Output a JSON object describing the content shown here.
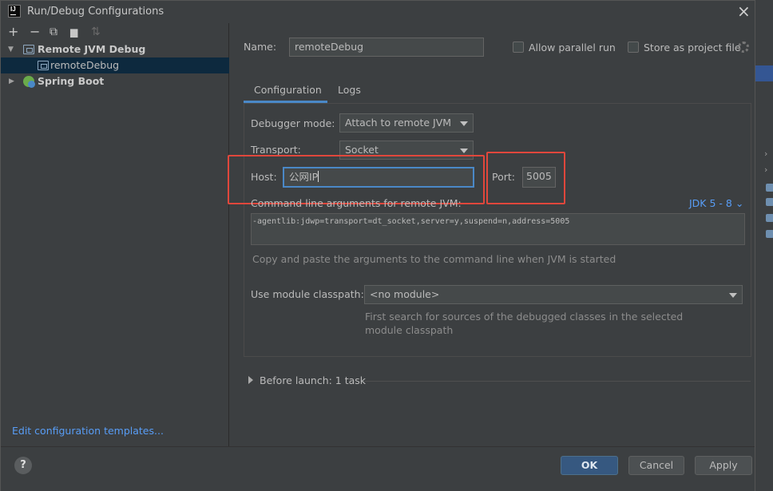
{
  "window": {
    "title": "Run/Debug Configurations",
    "app_icon": "IJ"
  },
  "toolbar": {
    "add": "+",
    "remove": "−",
    "copy": "⧉",
    "folder": "▆",
    "sort": "⇅"
  },
  "tree": {
    "items": [
      {
        "label": "Remote JVM Debug",
        "icon": "remote-jvm-icon"
      },
      {
        "label": "remoteDebug",
        "icon": "remote-config-icon"
      },
      {
        "label": "Spring Boot",
        "icon": "spring-boot-icon"
      }
    ]
  },
  "edit_templates": "Edit configuration templates...",
  "name_field": {
    "label": "Name:",
    "value": "remoteDebug"
  },
  "options": {
    "allow_parallel": "Allow parallel run",
    "store_project": "Store as project file"
  },
  "tabs": [
    {
      "label": "Configuration"
    },
    {
      "label": "Logs"
    }
  ],
  "debugger_mode": {
    "label": "Debugger mode:",
    "value": "Attach to remote JVM"
  },
  "transport": {
    "label": "Transport:",
    "value": "Socket"
  },
  "host": {
    "label": "Host:",
    "value": "公网IP"
  },
  "port": {
    "label": "Port:",
    "value": "5005"
  },
  "command_line": {
    "label": "Command line arguments for remote JVM:",
    "jdk": "JDK 5 - 8",
    "value": "-agentlib:jdwp=transport=dt_socket,server=y,suspend=n,address=5005",
    "hint": "Copy and paste the arguments to the command line when JVM is started"
  },
  "module_classpath": {
    "label": "Use module classpath:",
    "value": "<no module>",
    "hint_line1": "First search for sources of the debugged classes in the selected",
    "hint_line2": "module classpath"
  },
  "before_launch": "Before launch: 1 task",
  "buttons": {
    "help": "?",
    "ok": "OK",
    "cancel": "Cancel",
    "apply": "Apply"
  },
  "colors": {
    "accent": "#4a88c7",
    "highlight_box": "#e0473c",
    "link": "#589df6"
  }
}
